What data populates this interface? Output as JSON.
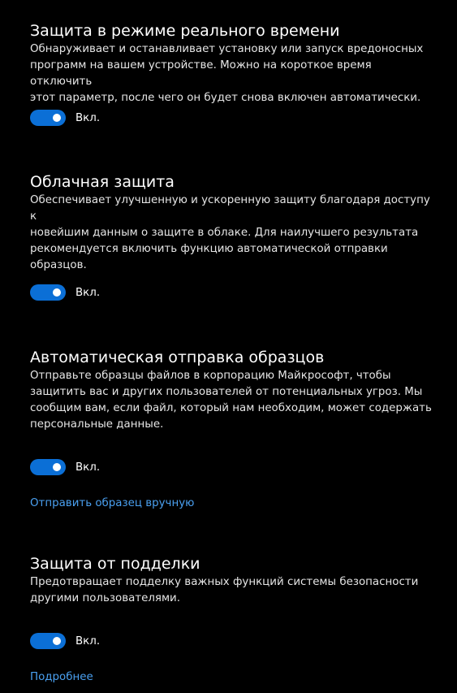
{
  "colors": {
    "background": "#000000",
    "toggle_on": "#0b6fd6",
    "link": "#4aa0f0"
  },
  "sections": [
    {
      "title": "Защита в режиме реального времени",
      "description": "Обнаруживает и останавливает установку или запуск вредоносных\nпрограмм на вашем устройстве. Можно на короткое время отключить\nэтот параметр, после чего он будет снова включен автоматически.",
      "toggle_on": true,
      "toggle_label": "Вкл."
    },
    {
      "title": "Облачная защита",
      "description": "Обеспечивает улучшенную и ускоренную защиту благодаря доступу к\nновейшим данным о защите в облаке. Для наилучшего результата\nрекомендуется включить функцию автоматической отправки\nобразцов.",
      "toggle_on": true,
      "toggle_label": "Вкл."
    },
    {
      "title": "Автоматическая отправка образцов",
      "description": "Отправьте образцы файлов в корпорацию Майкрософт, чтобы\nзащитить вас и других пользователей от потенциальных угроз. Мы\nсообщим вам, если файл, который нам необходим, может содержать\nперсональные данные.",
      "toggle_on": true,
      "toggle_label": "Вкл.",
      "link": "Отправить образец вручную"
    },
    {
      "title": "Защита от подделки",
      "description": "Предотвращает подделку важных функций системы безопасности\nдругими пользователями.",
      "toggle_on": true,
      "toggle_label": "Вкл.",
      "link": "Подробнее"
    }
  ]
}
